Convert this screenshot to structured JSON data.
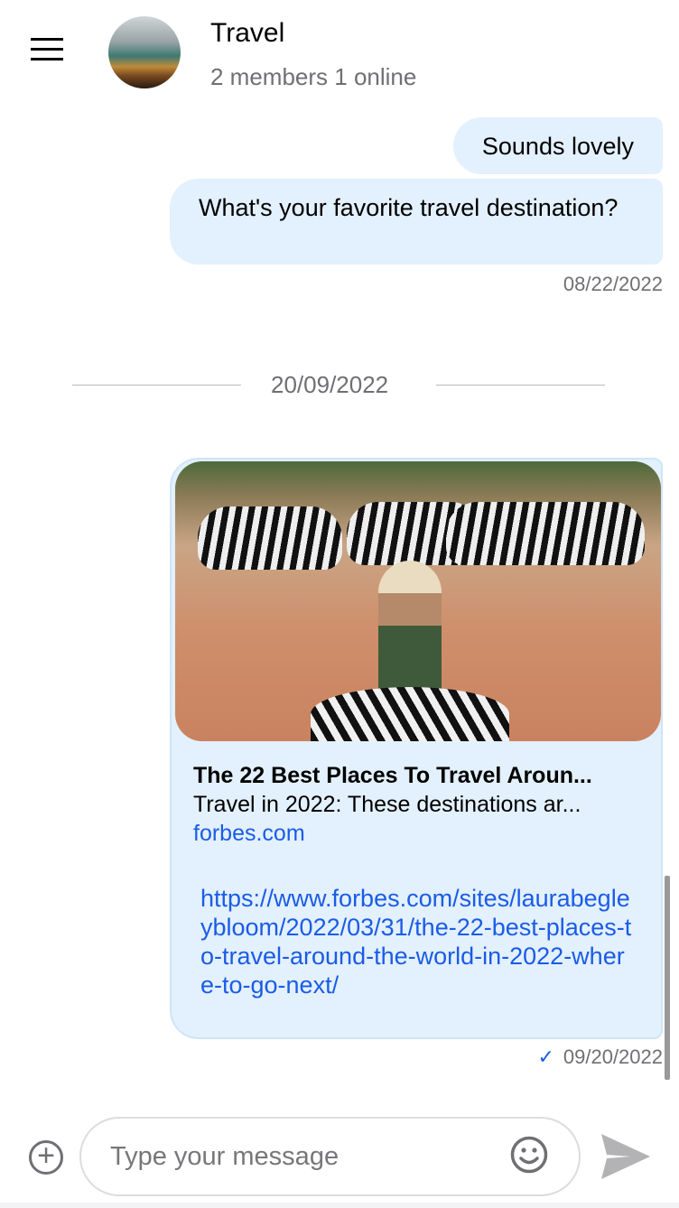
{
  "header": {
    "title": "Travel",
    "subtitle": "2 members 1 online",
    "menu_icon": "hamburger-icon",
    "avatar": "group-avatar"
  },
  "messages": [
    {
      "text": "Sounds lovely"
    },
    {
      "text": "What's your favorite travel destination?",
      "timestamp": "08/22/2022"
    }
  ],
  "date_divider": "20/09/2022",
  "link_message": {
    "preview_title": "The 22 Best Places To Travel Aroun...",
    "preview_description": "Travel in 2022: These destinations ar...",
    "preview_domain": "forbes.com",
    "url": "https://www.forbes.com/sites/laurabegleybloom/2022/03/31/the-22-best-places-to-travel-around-the-world-in-2022-where-to-go-next/",
    "status": "✓",
    "timestamp": "09/20/2022"
  },
  "composer": {
    "placeholder": "Type your message",
    "value": ""
  },
  "colors": {
    "bubble": "#e3f0fd",
    "link": "#1a5ce6",
    "muted": "#6f6f74"
  }
}
